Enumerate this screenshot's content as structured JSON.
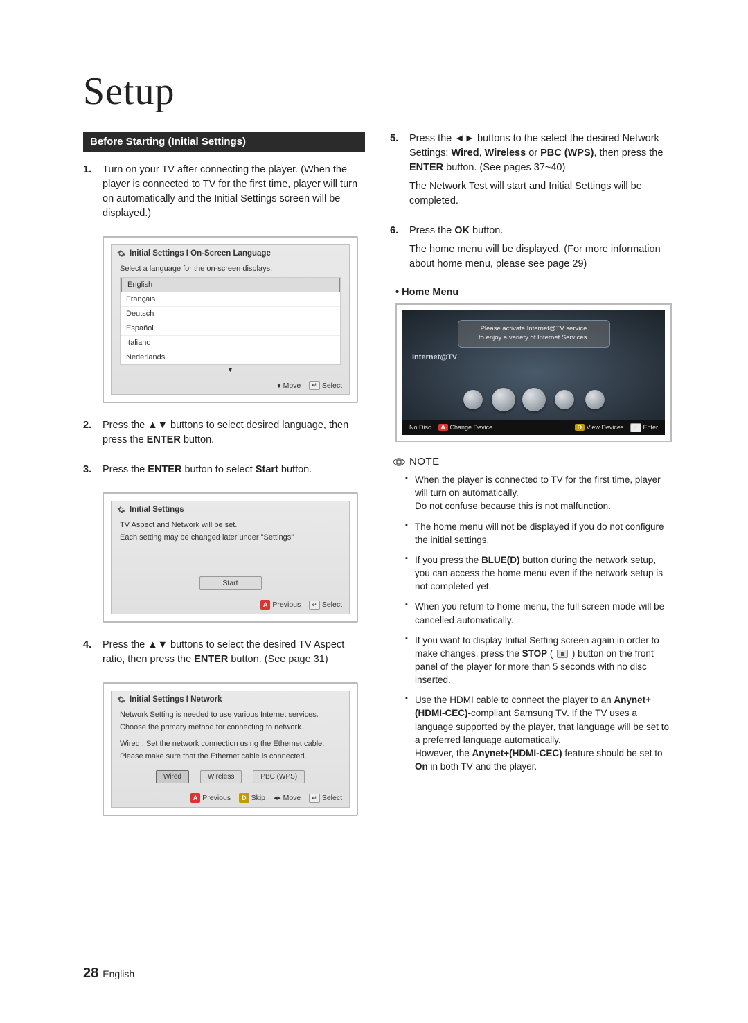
{
  "title": "Setup",
  "section_heading": "Before Starting (Initial Settings)",
  "left": {
    "step1": {
      "num": "1.",
      "p1": "Turn on your TV after connecting the player. (When the player is connected to TV for the first time, player will turn on automatically and the Initial Settings screen will be displayed.)"
    },
    "panel1": {
      "title": "Initial Settings I On-Screen Language",
      "instr": "Select a language for the on-screen displays.",
      "langs": [
        "English",
        "Français",
        "Deutsch",
        "Español",
        "Italiano",
        "Nederlands"
      ],
      "foot_move": "Move",
      "foot_select": "Select"
    },
    "step2": {
      "num": "2.",
      "t1": "Press the ",
      "t2": " buttons to select desired language, then press the ",
      "enter": "ENTER",
      "t3": " button."
    },
    "step3": {
      "num": "3.",
      "t1": "Press the ",
      "enter": "ENTER",
      "t2": " button to select ",
      "start": "Start",
      "t3": " button."
    },
    "panel2": {
      "title": "Initial Settings",
      "line1": "TV Aspect and Network will be set.",
      "line2": "Each setting may be changed later under \"Settings\"",
      "start_btn": "Start",
      "prev": "Previous",
      "select": "Select"
    },
    "step4": {
      "num": "4.",
      "t1": "Press the ",
      "t2": " buttons to select the desired TV Aspect ratio, then press the ",
      "enter": "ENTER",
      "t3": " button. (See page 31)"
    },
    "panel3": {
      "title": "Initial Settings I Network",
      "line1": "Network Setting is needed to use various Internet services.",
      "line2": "Choose the primary method for connecting to network.",
      "line3": "Wired : Set the network connection using the Ethernet cable.",
      "line4": "Please make sure that the Ethernet cable is connected.",
      "btns": [
        "Wired",
        "Wireless",
        "PBC (WPS)"
      ],
      "prev": "Previous",
      "skip": "Skip",
      "move": "Move",
      "select": "Select"
    }
  },
  "right": {
    "step5": {
      "num": "5.",
      "t1": "Press the ",
      "t2": " buttons to the select the desired Network Settings: ",
      "w1": "Wired",
      "sep1": ", ",
      "w2": "Wireless",
      "sep2": " or ",
      "w3": "PBC (WPS)",
      "t3": ", then press the ",
      "enter": "ENTER",
      "t4": " button. (See pages 37~40)",
      "p2": "The Network Test will start and Initial Settings will be completed."
    },
    "step6": {
      "num": "6.",
      "t1": "Press the ",
      "ok": "OK",
      "t2": " button.",
      "p2": "The home menu will be displayed. (For more information about home menu, please see page 29)"
    },
    "home_menu_label": "• Home Menu",
    "home_menu": {
      "bubble1": "Please activate Internet@TV service",
      "bubble2": "to enjoy a variety of Internet Services.",
      "label": "Internet@TV",
      "bar_no_disc": "No Disc",
      "bar_change": "Change Device",
      "bar_view": "View Devices",
      "bar_enter": "Enter"
    },
    "note_label": "NOTE",
    "notes": [
      {
        "p1": "When the player is connected to TV for the first time, player will turn on automatically.",
        "p2": "Do not confuse because this is not malfunction."
      },
      {
        "p1": "The home menu will not be displayed if you do not configure the initial settings."
      },
      {
        "t1": "If you press the ",
        "b1": "BLUE(D)",
        "t2": " button during the network setup, you can access the home menu even if the network setup is not completed yet."
      },
      {
        "p1": "When you return to home menu, the full screen mode will be cancelled automatically."
      },
      {
        "t1": "If you want to display Initial Setting screen again in order to make changes, press the ",
        "b1": "STOP",
        "t2": " ( ",
        "t3": " ) button on the front panel of the player for more than 5 seconds with no disc inserted."
      },
      {
        "t1": "Use the HDMI cable to connect the player to an ",
        "b1": "Anynet+(HDMI-CEC)",
        "t2": "-compliant Samsung TV. If the TV uses a language supported by the player, that language will be set to a preferred language automatically.",
        "p2a": "However, the ",
        "b2": "Anynet+(HDMI-CEC)",
        "p2b": " feature should be set to ",
        "b3": "On",
        "p2c": " in both TV and the player."
      }
    ]
  },
  "footer": {
    "page": "28",
    "lang": "English"
  }
}
